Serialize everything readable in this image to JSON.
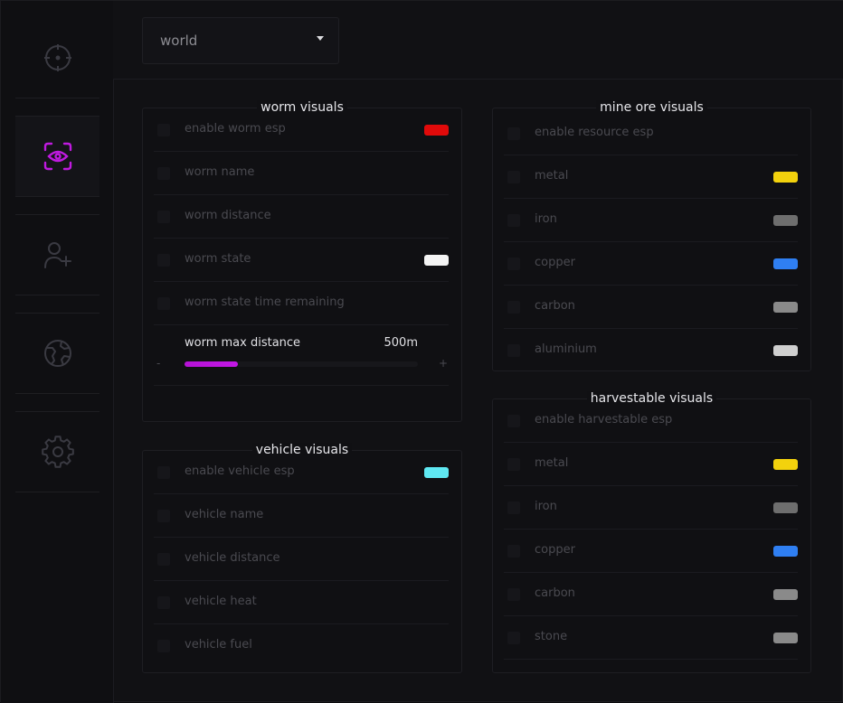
{
  "header": {
    "dropdown_value": "world"
  },
  "sidebar": {
    "items": [
      {
        "icon": "crosshair-icon",
        "active": false
      },
      {
        "icon": "eye-scan-icon",
        "active": true
      },
      {
        "icon": "user-add-icon",
        "active": false
      },
      {
        "icon": "globe-icon",
        "active": false
      },
      {
        "icon": "gear-icon",
        "active": false
      }
    ]
  },
  "colors": {
    "accent": "#c01ae0",
    "icon_inactive": "#3a3a42"
  },
  "worm": {
    "title": "worm visuals",
    "rows": [
      {
        "label": "enable worm esp",
        "color": "#e10a0a"
      },
      {
        "label": "worm name",
        "color": null
      },
      {
        "label": "worm distance",
        "color": null
      },
      {
        "label": "worm state",
        "color": "#f4f4f4"
      },
      {
        "label": "worm state time remaining",
        "color": null
      }
    ],
    "slider": {
      "label": "worm max distance",
      "value": "500m",
      "minus": "-",
      "plus": "+",
      "fraction": 0.23
    }
  },
  "vehicle": {
    "title": "vehicle visuals",
    "rows": [
      {
        "label": "enable vehicle esp",
        "color": "#5fe8f2"
      },
      {
        "label": "vehicle name",
        "color": null
      },
      {
        "label": "vehicle distance",
        "color": null
      },
      {
        "label": "vehicle heat",
        "color": null
      },
      {
        "label": "vehicle fuel",
        "color": null
      }
    ]
  },
  "ore": {
    "title": "mine ore visuals",
    "rows": [
      {
        "label": "enable resource esp",
        "color": null
      },
      {
        "label": "metal",
        "color": "#f3d20d"
      },
      {
        "label": "iron",
        "color": "#6e6e6e"
      },
      {
        "label": "copper",
        "color": "#2f7ff2"
      },
      {
        "label": "carbon",
        "color": "#8a8a8a"
      },
      {
        "label": "aluminium",
        "color": "#cfcfcf"
      }
    ]
  },
  "harvest": {
    "title": "harvestable visuals",
    "rows": [
      {
        "label": "enable harvestable esp",
        "color": null
      },
      {
        "label": "metal",
        "color": "#f3d20d"
      },
      {
        "label": "iron",
        "color": "#6e6e6e"
      },
      {
        "label": "copper",
        "color": "#2f7ff2"
      },
      {
        "label": "carbon",
        "color": "#8a8a8a"
      },
      {
        "label": "stone",
        "color": "#8a8a8a"
      }
    ]
  }
}
